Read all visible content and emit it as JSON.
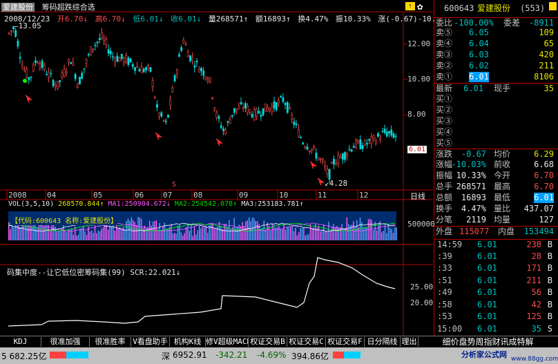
{
  "header": {
    "stock_name": "爱建股份",
    "indicator_name": "筹码超跌综合选",
    "date": "2008/12/23",
    "open": "开6.70↓",
    "high": "高6.70↓",
    "low": "低6.01↓",
    "close": "收6.01↓",
    "volume": "量268571↑",
    "amount": "额16893↑",
    "turnover": "换4.47%",
    "amplitude": "振10.33%",
    "change": "涨(-0.67)-10.03%"
  },
  "price_chart": {
    "max_label": "13.05",
    "min_label": "4.28",
    "current_price_tag": "6.01",
    "y_ticks": [
      "12.00",
      "10.00",
      "8.00"
    ],
    "x_ticks": [
      "2008",
      "04",
      "05",
      "06",
      "07",
      "08",
      "09",
      "10",
      "11",
      "12"
    ],
    "period_label": "日线",
    "marker_s": "S",
    "candles_summary": "daily candlesticks falling from about 13 in Jan 2008 to 4.28 in Nov 2008, rebound to about 7"
  },
  "volume_panel": {
    "title": "VOL(3,5,10)",
    "vol_value": "268570.844↑",
    "ma1": "MA1:250904.672↓",
    "ma2": "MA2:254542.078↑",
    "ma3": "MA3:253183.781↑",
    "code_label": "【代码:600643  名称:爱建股份】",
    "y_tick": "500000"
  },
  "chip_panel": {
    "title": "码集中度--让它低位密筹码集(99) SCR:22.021↓",
    "y_ticks": [
      "25.00",
      "20.00"
    ]
  },
  "quote": {
    "code": "600643",
    "name": "爱建股份",
    "sub": "(553)",
    "weibi_label": "委比",
    "weibi": "-100.00%",
    "weicha_label": "委差",
    "weicha": "-8911",
    "sells": [
      {
        "label": "卖⑤",
        "price": "6.05",
        "vol": "109"
      },
      {
        "label": "卖④",
        "price": "6.04",
        "vol": "65"
      },
      {
        "label": "卖③",
        "price": "6.03",
        "vol": "420"
      },
      {
        "label": "卖②",
        "price": "6.02",
        "vol": "211"
      },
      {
        "label": "卖①",
        "price": "6.01",
        "vol": "8106"
      }
    ],
    "latest_label": "最新",
    "latest": "6.01",
    "xianshou_label": "现手",
    "xianshou": "35",
    "buys": [
      "买①",
      "买②",
      "买③",
      "买④",
      "买⑤"
    ],
    "stats": [
      {
        "l1": "涨跌",
        "v1": "-0.67",
        "l2": "均价",
        "v2": "6.29"
      },
      {
        "l1": "涨幅",
        "v1": "-10.03%",
        "l2": "前收",
        "v2": "6.68"
      },
      {
        "l1": "振幅",
        "v1": "10.33%",
        "l2": "今开",
        "v2": "6.70"
      },
      {
        "l1": "总手",
        "v1": "268571",
        "l2": "最高",
        "v2": "6.70"
      },
      {
        "l1": "总额",
        "v1": "16893",
        "l2": "最低",
        "v2": "6.01"
      },
      {
        "l1": "换手",
        "v1": "4.47%",
        "l2": "量比",
        "v2": "437.07"
      },
      {
        "l1": "分笔",
        "v1": "2119",
        "l2": "均量",
        "v2": "127"
      }
    ],
    "waipan_label": "外盘",
    "waipan": "115077",
    "neipan_label": "内盘",
    "neipan": "153494",
    "ticks": [
      {
        "time": "14:59",
        "price": "6.01",
        "vol": "238",
        "side": "B"
      },
      {
        "time": ":39",
        "price": "6.01",
        "vol": "28",
        "side": "B"
      },
      {
        "time": ":33",
        "price": "6.01",
        "vol": "171",
        "side": "B"
      },
      {
        "time": ":51",
        "price": "6.01",
        "vol": "211",
        "side": "B"
      },
      {
        "time": ":49",
        "price": "6.01",
        "vol": "56",
        "side": "B"
      },
      {
        "time": ":58",
        "price": "6.01",
        "vol": "42",
        "side": "B"
      },
      {
        "time": ":53",
        "price": "6.01",
        "vol": "125",
        "side": "B"
      },
      {
        "time": "15:00",
        "price": "6.01",
        "vol": "35",
        "side": "S"
      }
    ]
  },
  "tabs": [
    "KDJ",
    "很准加强",
    "很准胜率",
    "V看盘助手",
    "机构K线",
    "修V超级MACD",
    "权证交易B",
    "权证交易C",
    "权证交易F",
    "日分隔线",
    "理出",
    "细价盘势周指财讯成特解"
  ],
  "status": {
    "sh_index": "5 682.25亿",
    "sz_label": "深",
    "sz_index": "6952.91",
    "sz_change": "-342.21",
    "sz_pct": "-4.69%",
    "sz_amount": "394.86亿",
    "brand": "分析家公式网",
    "brand_url": "www.88gg.com"
  },
  "colors": {
    "up": "#ff4b4b",
    "down": "#00d8d8",
    "bg": "#000000",
    "grid": "#b00000",
    "yellow": "#e6e600"
  }
}
